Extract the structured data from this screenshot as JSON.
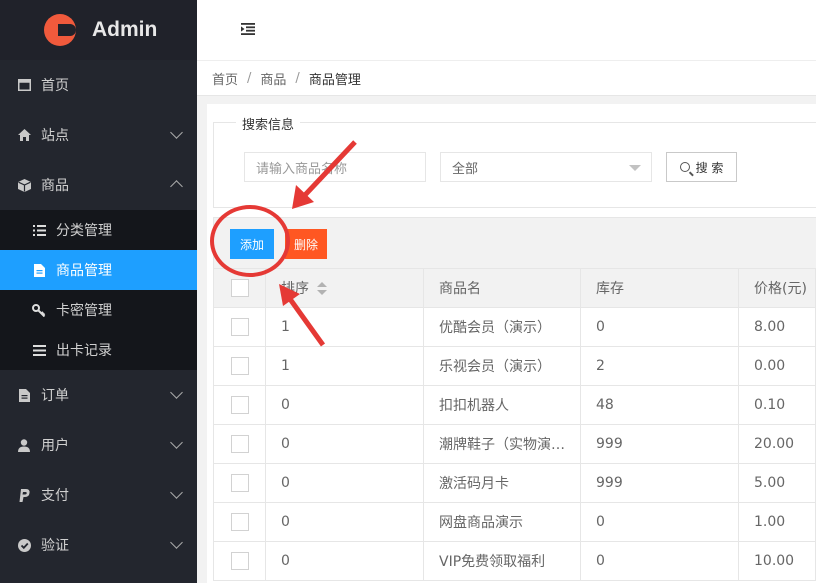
{
  "app": {
    "logo_text": "Admin"
  },
  "sidebar": {
    "items": [
      {
        "label": "首页",
        "icon": "window-icon"
      },
      {
        "label": "站点",
        "icon": "home-icon"
      },
      {
        "label": "商品",
        "icon": "box-icon"
      },
      {
        "label": "订单",
        "icon": "file-icon"
      },
      {
        "label": "用户",
        "icon": "user-icon"
      },
      {
        "label": "支付",
        "icon": "paypal-icon"
      },
      {
        "label": "验证",
        "icon": "check-circle-icon"
      }
    ],
    "submenu": [
      {
        "label": "分类管理",
        "icon": "list-icon"
      },
      {
        "label": "商品管理",
        "icon": "file-icon",
        "active": true
      },
      {
        "label": "卡密管理",
        "icon": "key-icon"
      },
      {
        "label": "出卡记录",
        "icon": "menu-icon"
      }
    ]
  },
  "breadcrumb": [
    "首页",
    "商品",
    "商品管理"
  ],
  "search": {
    "legend": "搜索信息",
    "placeholder": "请输入商品名称",
    "select_value": "全部",
    "button_label": "搜 索"
  },
  "toolbar": {
    "add_label": "添加",
    "delete_label": "删除"
  },
  "table": {
    "headers": [
      "排序",
      "商品名",
      "库存",
      "价格(元)"
    ],
    "rows": [
      [
        "1",
        "优酷会员（演示）",
        "0",
        "8.00"
      ],
      [
        "1",
        "乐视会员（演示）",
        "2",
        "0.00"
      ],
      [
        "0",
        "扣扣机器人",
        "48",
        "0.10"
      ],
      [
        "0",
        "潮牌鞋子（实物演…",
        "999",
        "20.00"
      ],
      [
        "0",
        "激活码月卡",
        "999",
        "5.00"
      ],
      [
        "0",
        "网盘商品演示",
        "0",
        "1.00"
      ],
      [
        "0",
        "VIP免费领取福利",
        "0",
        "10.00"
      ]
    ]
  },
  "colors": {
    "primary": "#1e9fff",
    "danger": "#ff5722",
    "sidebar_bg": "#23262e",
    "annotation": "#e53935"
  }
}
